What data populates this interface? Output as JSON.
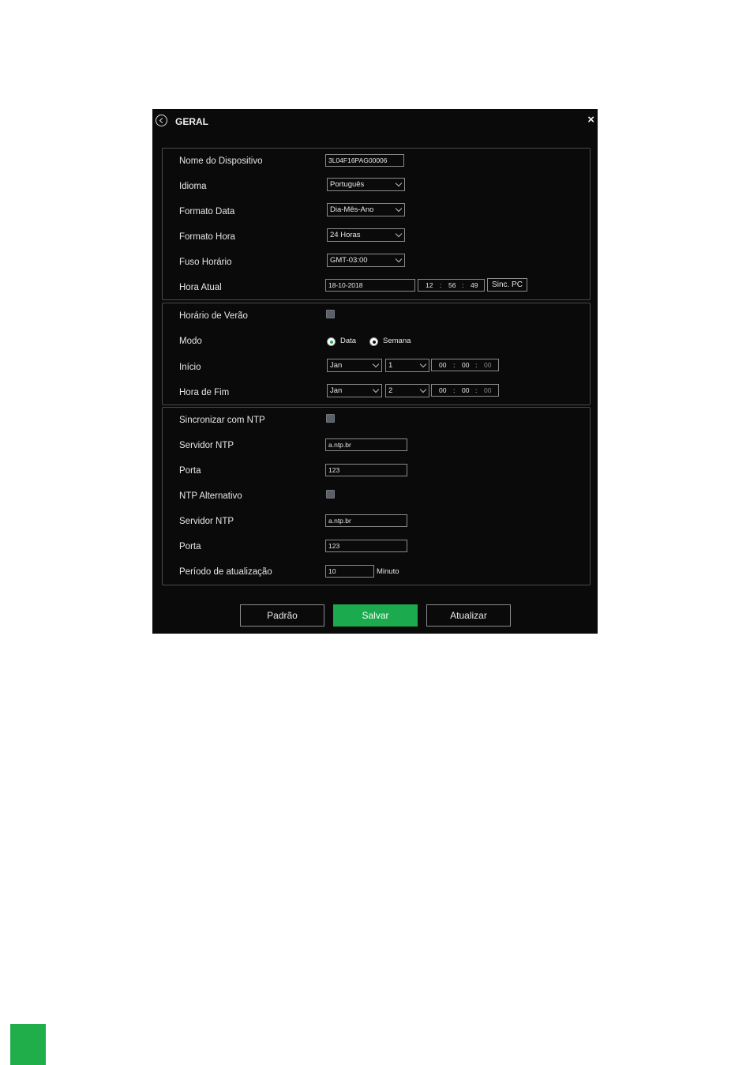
{
  "window": {
    "title": "GERAL",
    "close": "×"
  },
  "general": {
    "device_name_label": "Nome do Dispositivo",
    "device_name_value": "3L04F16PAG00006",
    "language_label": "Idioma",
    "language_value": "Português",
    "date_format_label": "Formato Data",
    "date_format_value": "Dia-Mês-Ano",
    "time_format_label": "Formato Hora",
    "time_format_value": "24 Horas",
    "timezone_label": "Fuso Horário",
    "timezone_value": "GMT-03:00",
    "current_time_label": "Hora Atual",
    "current_date_value": "18-10-2018",
    "current_hh": "12",
    "current_mm": "56",
    "current_ss": "49",
    "sync_pc_label": "Sinc. PC"
  },
  "dst": {
    "label": "Horário de Verão",
    "mode_label": "Modo",
    "mode_option_date": "Data",
    "mode_option_week": "Semana",
    "start_label": "Início",
    "start_month": "Jan",
    "start_day": "1",
    "start_hh": "00",
    "start_mm": "00",
    "start_ss": "00",
    "end_label": "Hora de Fim",
    "end_month": "Jan",
    "end_day": "2",
    "end_hh": "00",
    "end_mm": "00",
    "end_ss": "00",
    "sep": ":"
  },
  "ntp": {
    "sync_label": "Sincronizar com NTP",
    "server_label": "Servidor NTP",
    "server_value": "a.ntp.br",
    "port_label": "Porta",
    "port_value": "123",
    "alt_label": "NTP Alternativo",
    "alt_server_label": "Servidor NTP",
    "alt_server_value": "a.ntp.br",
    "alt_port_label": "Porta",
    "alt_port_value": "123",
    "period_label": "Período de atualização",
    "period_value": "10",
    "period_unit": "Minuto"
  },
  "buttons": {
    "default": "Padrão",
    "save": "Salvar",
    "update": "Atualizar"
  },
  "colors": {
    "accent": "#1bab4e",
    "window_bg": "#0a0a0a"
  }
}
